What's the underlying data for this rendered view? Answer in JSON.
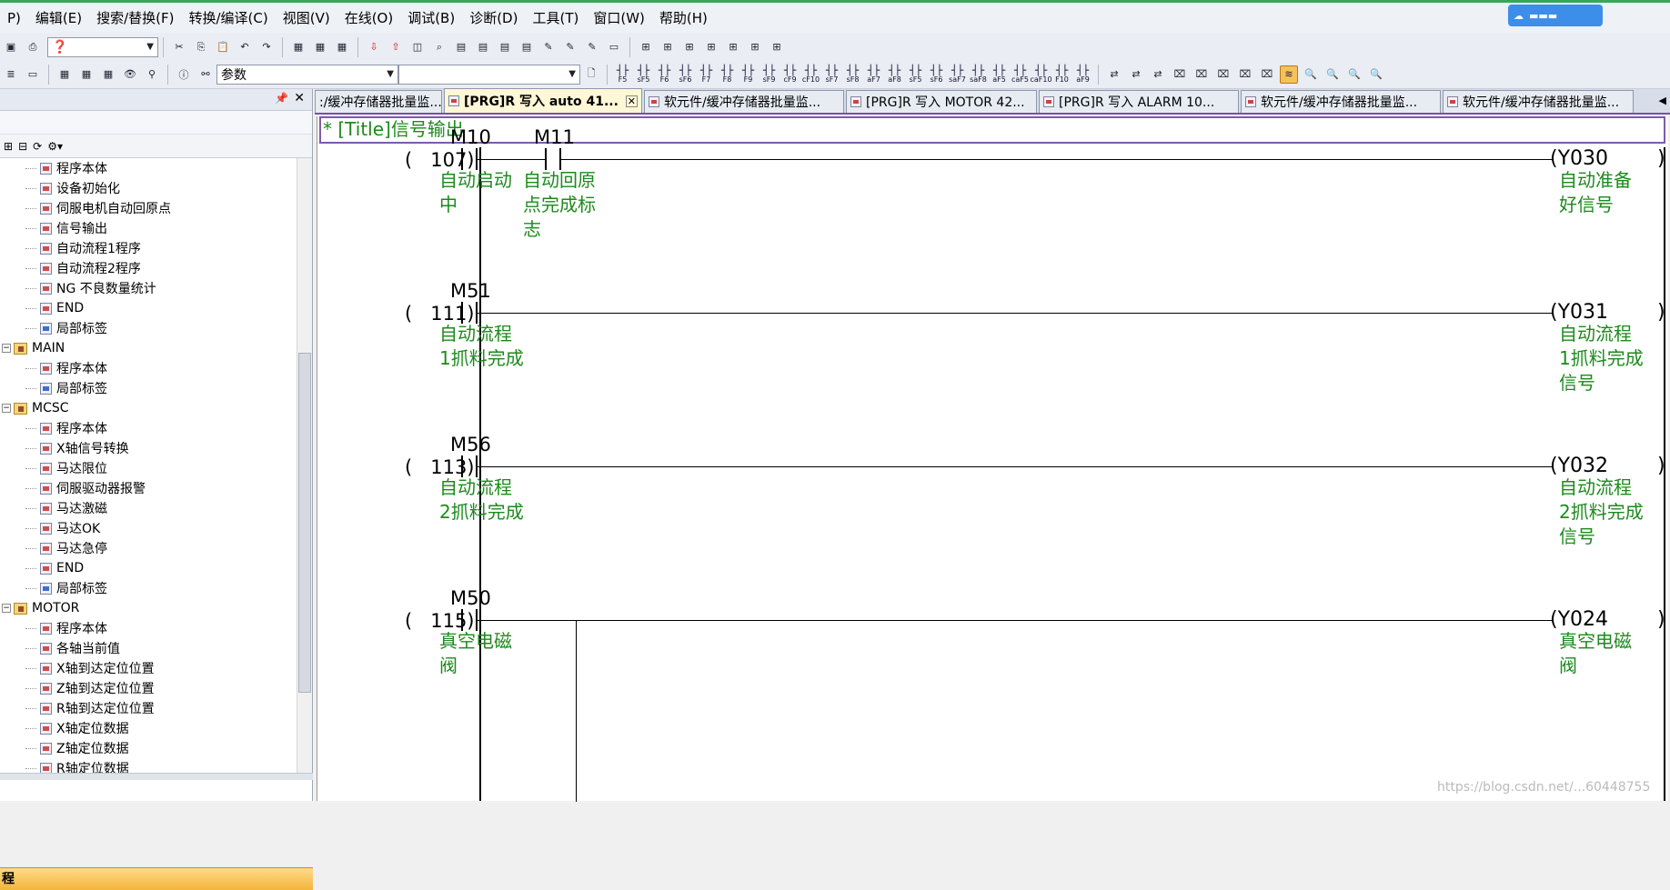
{
  "menu": [
    "P)",
    "编辑(E)",
    "搜索/替换(F)",
    "转换/编译(C)",
    "视图(V)",
    "在线(O)",
    "调试(B)",
    "诊断(D)",
    "工具(T)",
    "窗口(W)",
    "帮助(H)"
  ],
  "toolbar": {
    "combo_value": "参数"
  },
  "fkeys": [
    [
      "F5",
      ""
    ],
    [
      "sF5",
      ""
    ],
    [
      "F6",
      ""
    ],
    [
      "sF6",
      ""
    ],
    [
      "F7",
      ""
    ],
    [
      "F8",
      ""
    ],
    [
      "F9",
      ""
    ],
    [
      "sF9",
      ""
    ],
    [
      "cF9",
      ""
    ],
    [
      "cF10",
      ""
    ],
    [
      "sF7",
      ""
    ],
    [
      "sF8",
      ""
    ],
    [
      "aF7",
      ""
    ],
    [
      "aF8",
      ""
    ],
    [
      "sF5",
      ""
    ],
    [
      "sF6",
      ""
    ],
    [
      "saF7",
      ""
    ],
    [
      "saF8",
      ""
    ],
    [
      "aF5",
      ""
    ],
    [
      "caF5",
      ""
    ],
    [
      "caF10",
      ""
    ],
    [
      "F10",
      ""
    ],
    [
      "aF9",
      ""
    ]
  ],
  "sidebar": {
    "tree": [
      {
        "label": "程序本体",
        "indent": 2,
        "kind": "prog"
      },
      {
        "label": "设备初始化",
        "indent": 2,
        "kind": "prog"
      },
      {
        "label": "伺服电机自动回原点",
        "indent": 2,
        "kind": "prog"
      },
      {
        "label": "信号输出",
        "indent": 2,
        "kind": "prog"
      },
      {
        "label": "自动流程1程序",
        "indent": 2,
        "kind": "prog"
      },
      {
        "label": "自动流程2程序",
        "indent": 2,
        "kind": "prog"
      },
      {
        "label": "NG 不良数量统计",
        "indent": 2,
        "kind": "prog"
      },
      {
        "label": "END",
        "indent": 2,
        "kind": "prog"
      },
      {
        "label": "局部标签",
        "indent": 2,
        "kind": "lbl"
      },
      {
        "label": "MAIN",
        "indent": 0,
        "kind": "folder"
      },
      {
        "label": "程序本体",
        "indent": 2,
        "kind": "prog"
      },
      {
        "label": "局部标签",
        "indent": 2,
        "kind": "lbl"
      },
      {
        "label": "MCSC",
        "indent": 0,
        "kind": "folder"
      },
      {
        "label": "程序本体",
        "indent": 2,
        "kind": "prog"
      },
      {
        "label": "X轴信号转换",
        "indent": 2,
        "kind": "prog"
      },
      {
        "label": "马达限位",
        "indent": 2,
        "kind": "prog"
      },
      {
        "label": "伺服驱动器报警",
        "indent": 2,
        "kind": "prog"
      },
      {
        "label": "马达激磁",
        "indent": 2,
        "kind": "prog"
      },
      {
        "label": "马达OK",
        "indent": 2,
        "kind": "prog"
      },
      {
        "label": "马达急停",
        "indent": 2,
        "kind": "prog"
      },
      {
        "label": "END",
        "indent": 2,
        "kind": "prog"
      },
      {
        "label": "局部标签",
        "indent": 2,
        "kind": "lbl"
      },
      {
        "label": "MOTOR",
        "indent": 0,
        "kind": "folder"
      },
      {
        "label": "程序本体",
        "indent": 2,
        "kind": "prog"
      },
      {
        "label": "各轴当前值",
        "indent": 2,
        "kind": "prog"
      },
      {
        "label": "X轴到达定位位置",
        "indent": 2,
        "kind": "prog"
      },
      {
        "label": "Z轴到达定位位置",
        "indent": 2,
        "kind": "prog"
      },
      {
        "label": "R轴到达定位位置",
        "indent": 2,
        "kind": "prog"
      },
      {
        "label": "X轴定位数据",
        "indent": 2,
        "kind": "prog"
      },
      {
        "label": "Z轴定位数据",
        "indent": 2,
        "kind": "prog"
      },
      {
        "label": "R轴定位数据",
        "indent": 2,
        "kind": "prog"
      }
    ],
    "footer": "程"
  },
  "tabs": [
    {
      "label": ":/缓冲存储器批量监...",
      "active": false,
      "width": 140
    },
    {
      "label": "[PRG]R 写入 auto 41...",
      "active": true,
      "width": 218
    },
    {
      "label": "软元件/缓冲存储器批量监...",
      "active": false,
      "width": 220
    },
    {
      "label": "[PRG]R 写入 MOTOR 42...",
      "active": false,
      "width": 210
    },
    {
      "label": "[PRG]R 写入 ALARM 10...",
      "active": false,
      "width": 220
    },
    {
      "label": "软元件/缓冲存储器批量监...",
      "active": false,
      "width": 220
    },
    {
      "label": "软元件/缓冲存储器批量监...",
      "active": false,
      "width": 210
    }
  ],
  "editor": {
    "title": "* [Title]信号输出",
    "rungs": [
      {
        "step": "(   107)",
        "contacts": [
          {
            "device": "M10",
            "comment": [
              "自动启动",
              "中"
            ]
          },
          {
            "device": "M11",
            "comment": [
              "自动回原",
              "点完成标",
              "志"
            ]
          }
        ],
        "coil": "Y030",
        "coil_comment": [
          "自动准备",
          "好信号"
        ]
      },
      {
        "step": "(   111)",
        "contacts": [
          {
            "device": "M51",
            "comment": [
              "自动流程",
              "1抓料完成"
            ]
          }
        ],
        "coil": "Y031",
        "coil_comment": [
          "自动流程",
          "1抓料完成",
          "信号"
        ]
      },
      {
        "step": "(   113)",
        "contacts": [
          {
            "device": "M56",
            "comment": [
              "自动流程",
              "2抓料完成"
            ]
          }
        ],
        "coil": "Y032",
        "coil_comment": [
          "自动流程",
          "2抓料完成",
          "信号"
        ]
      },
      {
        "step": "(   115)",
        "contacts": [
          {
            "device": "M50",
            "comment": [
              "真空电磁",
              "阀"
            ]
          }
        ],
        "coil": "Y024",
        "coil_comment": [
          "真空电磁",
          "阀"
        ]
      }
    ]
  },
  "watermark": "https://blog.csdn.net/...60448755"
}
